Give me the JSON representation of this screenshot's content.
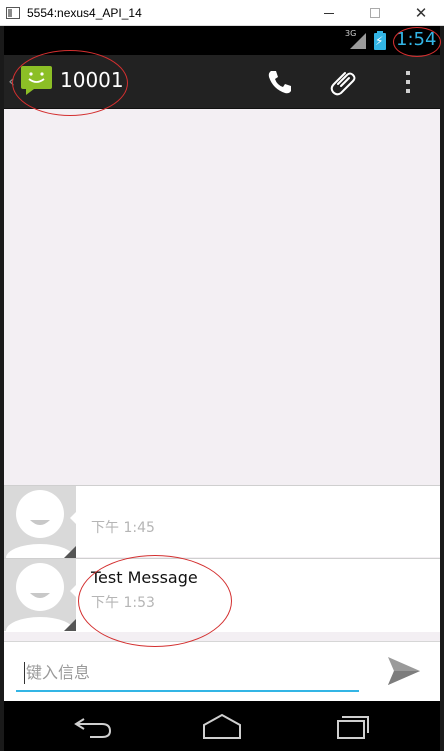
{
  "window": {
    "title": "5554:nexus4_API_14",
    "minimize_label": "",
    "maximize_label": "",
    "close_label": "✕"
  },
  "status_bar": {
    "network_type": "3G",
    "time": "1:54"
  },
  "action_bar": {
    "up_caret": "‹",
    "contact": "10001",
    "icons": [
      "messaging-app-icon",
      "phone-icon",
      "attach-icon",
      "overflow-menu-icon"
    ]
  },
  "messages": [
    {
      "text": "",
      "time": "下午 1:45"
    },
    {
      "text": "Test Message",
      "time": "下午 1:53"
    }
  ],
  "compose": {
    "placeholder": "键入信息",
    "value": ""
  },
  "nav_bar": {
    "icons": [
      "back-icon",
      "home-icon",
      "recent-apps-icon"
    ]
  },
  "colors": {
    "accent": "#33b5e5",
    "action_bar": "#222222",
    "conversation_bg": "#f3eff3",
    "annotation": "#d32f2f",
    "app_icon_green": "#8cbf26"
  }
}
